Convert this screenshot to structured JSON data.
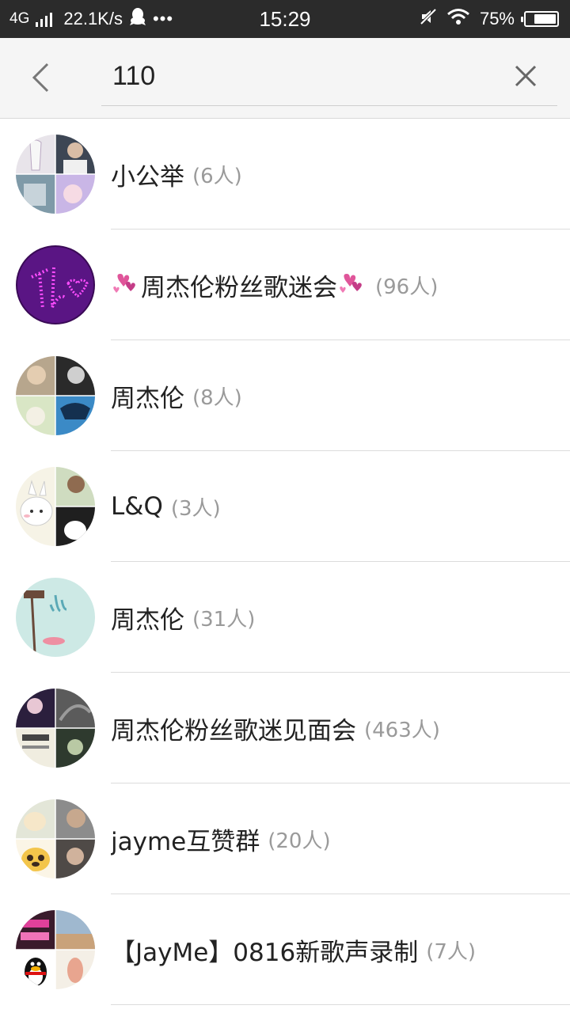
{
  "status_bar": {
    "network": "4G",
    "speed": "22.1K/s",
    "dots": "•••",
    "time": "15:29",
    "battery": "75%",
    "battery_level": 0.75
  },
  "search": {
    "value": "110",
    "back_icon": "chevron-left-icon",
    "clear_icon": "close-icon"
  },
  "results": [
    {
      "name": "小公举",
      "count": "(6人)"
    },
    {
      "name": "周杰伦粉丝歌迷会",
      "count": "(96人)",
      "decorated": true
    },
    {
      "name": "周杰伦",
      "count": "(8人)"
    },
    {
      "name": "L&Q",
      "count": "(3人)"
    },
    {
      "name": "周杰伦",
      "count": "(31人)"
    },
    {
      "name": "周杰伦粉丝歌迷见面会",
      "count": "(463人)"
    },
    {
      "name": "jayme互赞群",
      "count": "(20人)"
    },
    {
      "name": "【JayMe】0816新歌声录制",
      "count": "(7人)"
    }
  ],
  "colors": {
    "status_bar_bg": "#2b2b2b",
    "header_bg": "#f5f5f5",
    "divider": "#dcdcdc",
    "count_text": "#9a9a9a",
    "heart_pink": "#e0559a"
  }
}
